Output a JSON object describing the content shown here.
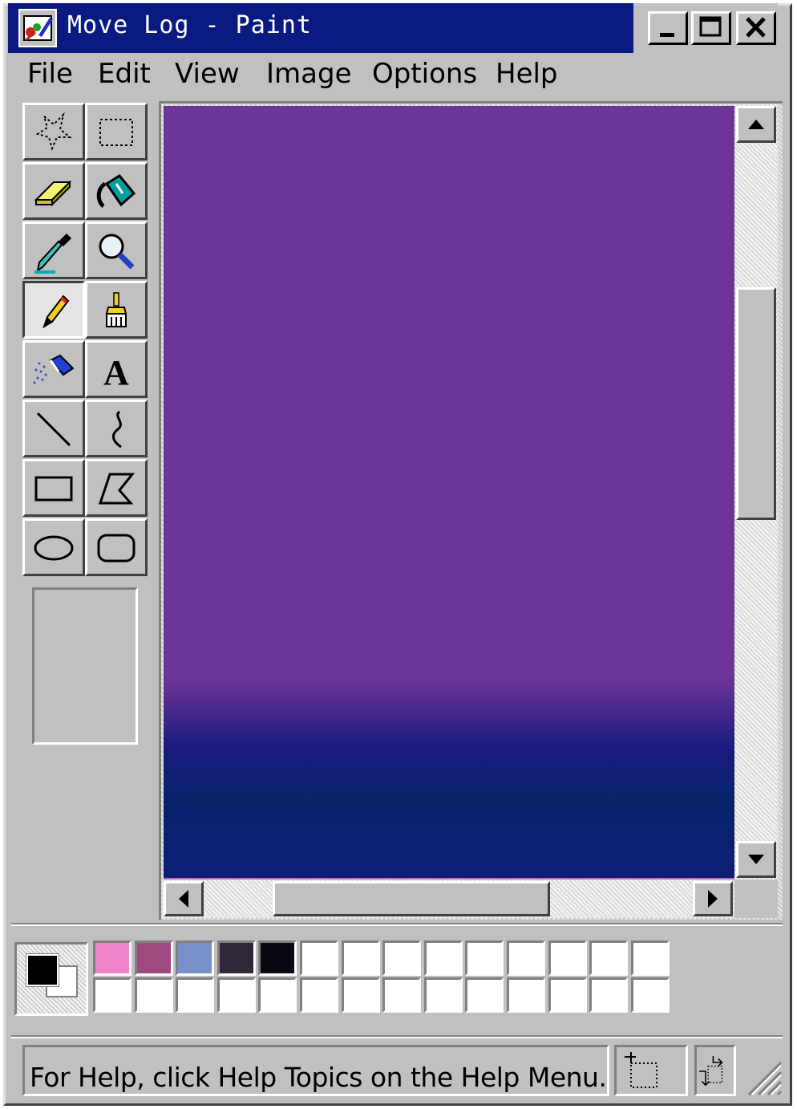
{
  "window": {
    "title": "Move Log - Paint"
  },
  "menu": {
    "items": [
      "File",
      "Edit",
      "View",
      "Image",
      "Options",
      "Help"
    ]
  },
  "tools": [
    {
      "name": "free-form-select",
      "icon": "free-form-select-icon"
    },
    {
      "name": "select",
      "icon": "rectangle-select-icon"
    },
    {
      "name": "eraser",
      "icon": "eraser-icon"
    },
    {
      "name": "fill-with-color",
      "icon": "paint-bucket-icon"
    },
    {
      "name": "pick-color",
      "icon": "eyedropper-icon"
    },
    {
      "name": "magnifier",
      "icon": "magnifier-icon"
    },
    {
      "name": "pencil",
      "icon": "pencil-icon",
      "selected": true
    },
    {
      "name": "brush",
      "icon": "brush-icon"
    },
    {
      "name": "airbrush",
      "icon": "airbrush-icon"
    },
    {
      "name": "text",
      "icon": "text-icon"
    },
    {
      "name": "line",
      "icon": "line-icon"
    },
    {
      "name": "curve",
      "icon": "curve-icon"
    },
    {
      "name": "rectangle",
      "icon": "rectangle-icon"
    },
    {
      "name": "polygon",
      "icon": "polygon-icon"
    },
    {
      "name": "ellipse",
      "icon": "ellipse-icon"
    },
    {
      "name": "rounded-rectangle",
      "icon": "rounded-rectangle-icon"
    }
  ],
  "colors": {
    "foreground": "#000000",
    "background": "#ffffff",
    "canvas_top": "#6e3598",
    "canvas_bottom": "#0c1f78",
    "title_bar": "#0a1a80"
  },
  "palette": {
    "row1": [
      "#ef84c8",
      "#a04880",
      "#7890c8",
      "#302838",
      "#080810",
      "#ffffff",
      "#ffffff",
      "#ffffff",
      "#ffffff",
      "#ffffff",
      "#ffffff",
      "#ffffff",
      "#ffffff",
      "#ffffff"
    ],
    "row2": [
      "#ffffff",
      "#ffffff",
      "#ffffff",
      "#ffffff",
      "#ffffff",
      "#ffffff",
      "#ffffff",
      "#ffffff",
      "#ffffff",
      "#ffffff",
      "#ffffff",
      "#ffffff",
      "#ffffff",
      "#ffffff"
    ]
  },
  "status": {
    "help_text": "For Help, click Help Topics on the Help Menu."
  }
}
